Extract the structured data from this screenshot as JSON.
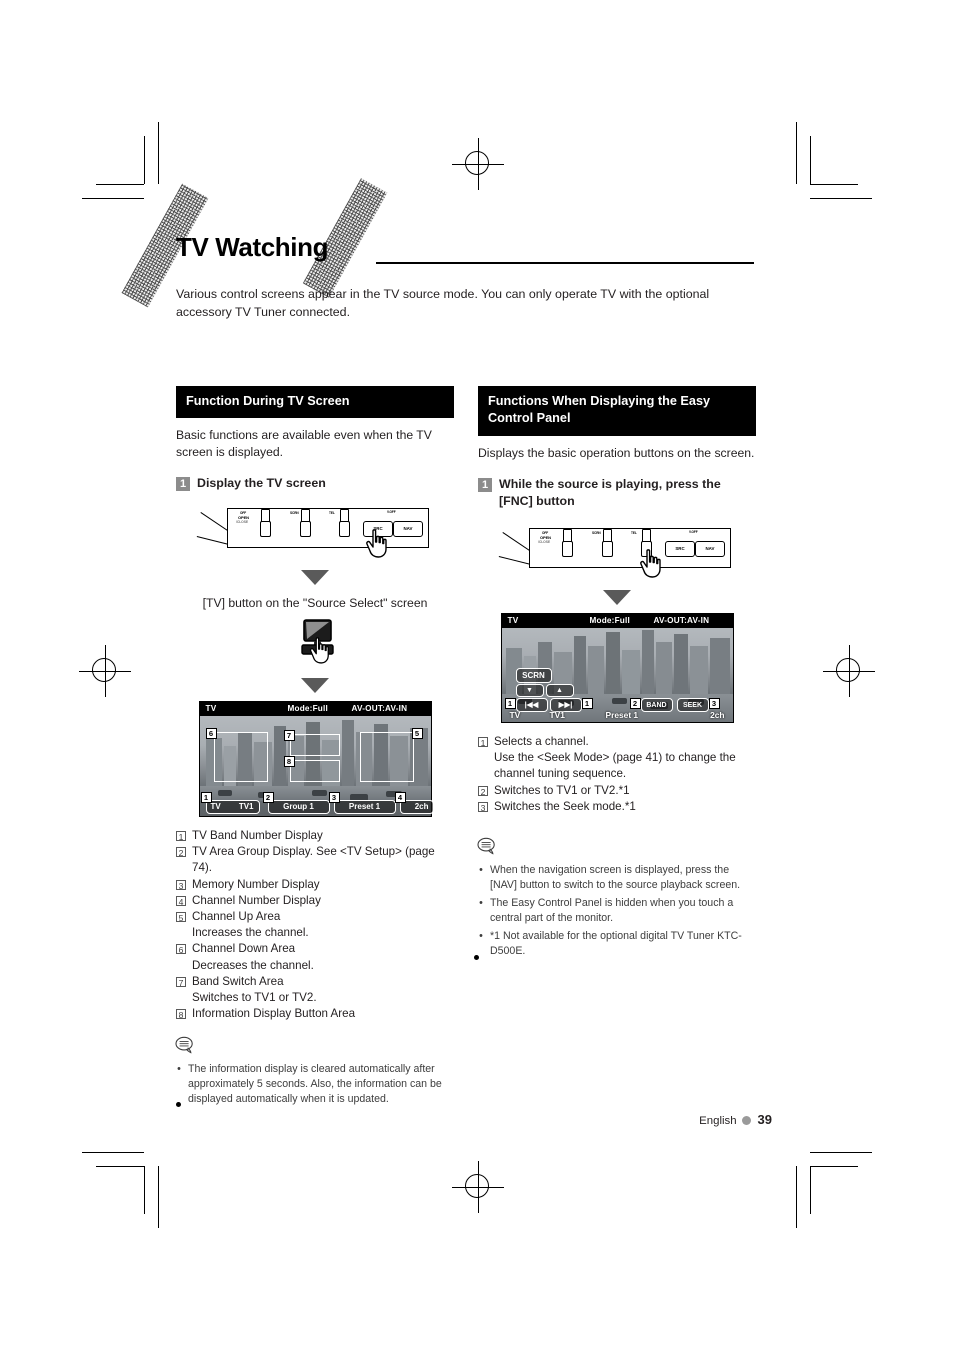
{
  "document": {
    "title": "TV Watching",
    "intro": "Various control screens appear in the TV source mode. You can only operate TV with the optional accessory TV Tuner connected.",
    "footer_language": "English",
    "footer_page": "39"
  },
  "left_column": {
    "section_title": "Function During TV Screen",
    "body": "Basic functions are available even when the TV screen is displayed.",
    "step": {
      "num": "1",
      "text": "Display the TV screen"
    },
    "caption": "[TV] button on the \"Source Select\" screen",
    "faceplate": {
      "labels": [
        "OFF",
        "OPEN",
        "/CLOSE",
        "SCRN",
        "TEL",
        "V.OFF"
      ],
      "keys": [
        "SRC",
        "NAV"
      ]
    },
    "tv_screen": {
      "top_left": "TV",
      "top_mode": "Mode:Full",
      "top_av": "AV-OUT:AV-IN",
      "bottom_band": "TV",
      "bottom_band_value": "TV1",
      "bottom_group": "Group 1",
      "bottom_preset": "Preset 1",
      "bottom_channel": "2ch",
      "callouts": [
        "1",
        "2",
        "3",
        "4",
        "5",
        "6",
        "7",
        "8"
      ]
    },
    "items": [
      {
        "num": "1",
        "text": "TV Band Number Display",
        "sub": ""
      },
      {
        "num": "2",
        "text": "TV Area Group Display. See <TV Setup> (page 74).",
        "sub": ""
      },
      {
        "num": "3",
        "text": "Memory Number Display",
        "sub": ""
      },
      {
        "num": "4",
        "text": "Channel Number Display",
        "sub": ""
      },
      {
        "num": "5",
        "text": "Channel Up Area",
        "sub": "Increases the channel."
      },
      {
        "num": "6",
        "text": "Channel Down Area",
        "sub": "Decreases the channel."
      },
      {
        "num": "7",
        "text": "Band Switch Area",
        "sub": "Switches to TV1 or TV2."
      },
      {
        "num": "8",
        "text": "Information Display Button Area",
        "sub": ""
      }
    ],
    "notes": [
      "The information display is cleared automatically after approximately 5 seconds. Also, the information can be displayed automatically when it is updated."
    ]
  },
  "right_column": {
    "section_title": "Functions When Displaying the Easy Control Panel",
    "body": "Displays the basic operation buttons on the screen.",
    "step": {
      "num": "1",
      "text": "While the source is playing, press the [FNC] button"
    },
    "faceplate": {
      "labels": [
        "OFF",
        "OPEN",
        "/CLOSE",
        "SCRN",
        "TEL",
        "V.OFF"
      ],
      "keys": [
        "SRC",
        "NAV"
      ]
    },
    "tv_screen": {
      "top_left": "TV",
      "top_mode": "Mode:Full",
      "top_av": "AV-OUT:AV-IN",
      "scrn_button": "SCRN",
      "band_button": "BAND",
      "seek_button": "SEEK",
      "bottom_band": "TV",
      "bottom_band_value": "TV1",
      "bottom_preset": "Preset 1",
      "bottom_channel": "2ch",
      "callouts": [
        "1",
        "1",
        "2",
        "3"
      ]
    },
    "items": [
      {
        "num": "1",
        "text": "Selects a channel.",
        "sub": "Use the <Seek Mode> (page 41) to change the channel tuning sequence."
      },
      {
        "num": "2",
        "text": "Switches to TV1 or TV2.*1",
        "sub": ""
      },
      {
        "num": "3",
        "text": "Switches the Seek mode.*1",
        "sub": ""
      }
    ],
    "notes": [
      "When the navigation screen is displayed, press the [NAV] button to switch to the source playback screen.",
      "The Easy Control Panel is hidden when you touch a central part of the monitor.",
      "*1 Not available for the optional digital TV Tuner KTC-D500E."
    ]
  }
}
